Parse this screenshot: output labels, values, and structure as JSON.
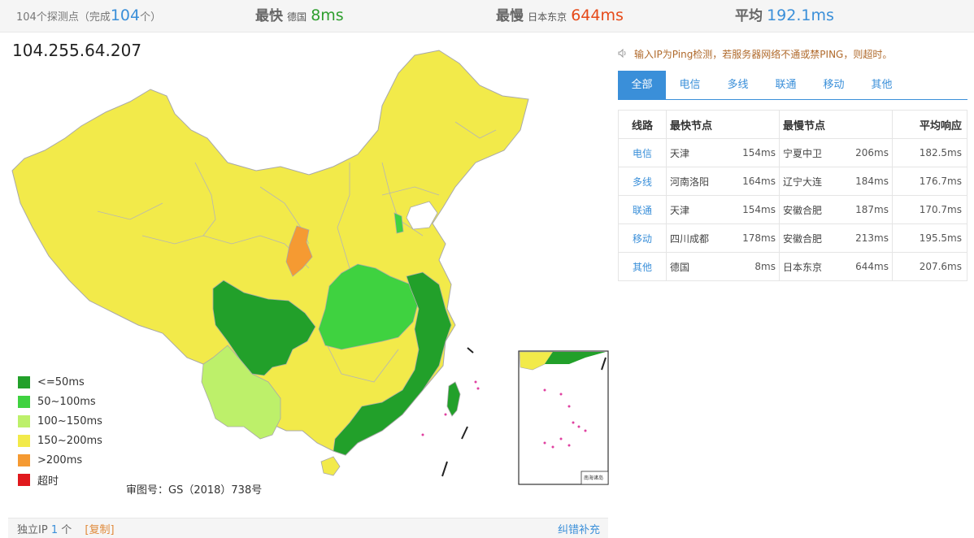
{
  "summary": {
    "probe_prefix": "104个探测点（完成",
    "probe_done": "104",
    "probe_suffix": "个）",
    "fastest_label": "最快",
    "fastest_loc": "德国",
    "fastest_val": "8ms",
    "slowest_label": "最慢",
    "slowest_loc": "日本东京",
    "slowest_val": "644ms",
    "avg_label": "平均",
    "avg_val": "192.1ms"
  },
  "ip": "104.255.64.207",
  "legend": [
    {
      "label": "<=50ms",
      "color": "#22a02a"
    },
    {
      "label": "50~100ms",
      "color": "#3fd240"
    },
    {
      "label": "100~150ms",
      "color": "#bdf06a"
    },
    {
      "label": "150~200ms",
      "color": "#f2ea4a"
    },
    {
      "label": ">200ms",
      "color": "#f59a32"
    },
    {
      "label": "超时",
      "color": "#e0191d"
    }
  ],
  "audit_no": "审图号：GS（2018）738号",
  "map_text": {
    "nanhai": "南海诸岛"
  },
  "notice": "输入IP为Ping检测，若服务器网络不通或禁PING，则超时。",
  "tabs": [
    "全部",
    "电信",
    "多线",
    "联通",
    "移动",
    "其他"
  ],
  "table": {
    "headers": [
      "线路",
      "最快节点",
      "最慢节点",
      "平均响应"
    ],
    "rows": [
      {
        "line": "电信",
        "fast_node": "天津",
        "fast_ms": "154ms",
        "slow_node": "宁夏中卫",
        "slow_ms": "206ms",
        "avg": "182.5ms"
      },
      {
        "line": "多线",
        "fast_node": "河南洛阳",
        "fast_ms": "164ms",
        "slow_node": "辽宁大连",
        "slow_ms": "184ms",
        "avg": "176.7ms"
      },
      {
        "line": "联通",
        "fast_node": "天津",
        "fast_ms": "154ms",
        "slow_node": "安徽合肥",
        "slow_ms": "187ms",
        "avg": "170.7ms"
      },
      {
        "line": "移动",
        "fast_node": "四川成都",
        "fast_ms": "178ms",
        "slow_node": "安徽合肥",
        "slow_ms": "213ms",
        "avg": "195.5ms"
      },
      {
        "line": "其他",
        "fast_node": "德国",
        "fast_ms": "8ms",
        "slow_node": "日本东京",
        "slow_ms": "644ms",
        "avg": "207.6ms"
      }
    ]
  },
  "bottom": {
    "ip_label": "独立IP",
    "ip_count": "1",
    "ip_unit": "个",
    "copy": "[复制]",
    "fix": "纠错补充"
  }
}
